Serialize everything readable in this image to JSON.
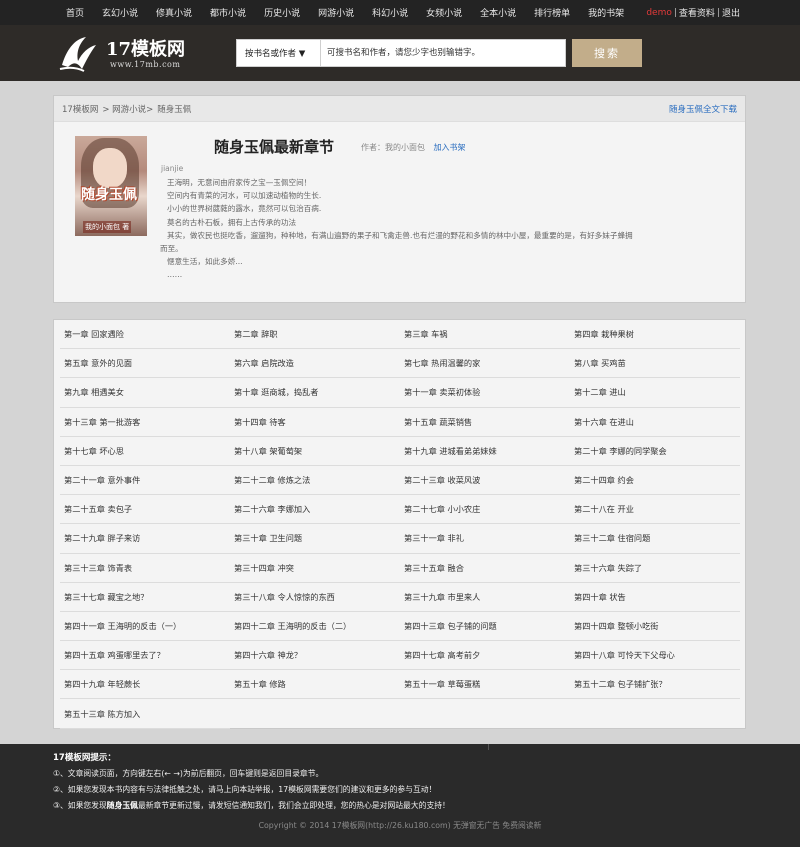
{
  "nav": {
    "items": [
      "首页",
      "玄幻小说",
      "修真小说",
      "都市小说",
      "历史小说",
      "网游小说",
      "科幻小说",
      "女频小说",
      "全本小说",
      "排行榜单",
      "我的书架"
    ],
    "user": "demo",
    "profile_link": "查看资料",
    "logout_link": "退出"
  },
  "logo": {
    "name": "17模板网",
    "url": "www.17mb.com"
  },
  "search": {
    "type_selected": "按书名或作者 ▼",
    "placeholder": "可搜书名和作者，请您少字也别输错字。",
    "button": "搜索"
  },
  "breadcrumb": [
    "17模板网",
    "> 网游小说>",
    "随身玉佩"
  ],
  "download_link": "随身玉佩全文下载",
  "book": {
    "title": "随身玉佩最新章节",
    "author_label": "作者：我的小面包",
    "add_shelf": "加入书架",
    "category": "jianjie",
    "cover_title": "随身玉佩",
    "cover_author": "我的小面包 著",
    "intro": [
      "王海明，无意间由府家传之宝—玉佩空间！",
      "空间内有青菜的河水，可以加速动植物的生长.",
      "小小的世界树葳蕤的露水，竟然可以包治百病.",
      "莫名的古朴石板，拥有上古传承的功法",
      "其实，做农民也挺吃香，遛遛狗，种种地，有满山遍野的果子和飞禽走兽.也有烂漫的野花和多情的林中小屋，最重要的是，有好多妹子蜂拥",
      "而至。",
      "惬意生活，如此多娇...",
      "……"
    ]
  },
  "chapters": [
    "第一章 回家遇险",
    "第二章 辞职",
    "第三章 车祸",
    "第四章 栽种果树",
    "第五章 意外的见面",
    "第六章 启院改造",
    "第七章 热闹温馨的家",
    "第八章 买鸡苗",
    "第九章 相遇美女",
    "第十章 逛商城，捣乱者",
    "第十一章 卖菜初体验",
    "第十二章 进山",
    "第十三章 第一批游客",
    "第十四章 待客",
    "第十五章 蔬菜销售",
    "第十六章 在进山",
    "第十七章 坏心思",
    "第十八章 架葡萄架",
    "第十九章 进城看弟弟妹妹",
    "第二十章 李娜的同学聚会",
    "第二十一章 意外事件",
    "第二十二章 修炼之法",
    "第二十三章 收菜风波",
    "第二十四章 约会",
    "第二十五章 卖包子",
    "第二十六章 李娜加入",
    "第二十七章 小小农庄",
    "第二十八在 开业",
    "第二十九章 胖子来访",
    "第三十章 卫生问题",
    "第三十一章 非礼",
    "第三十二章 住宿问题",
    "第三十三章 饰青表",
    "第三十四章 冲突",
    "第三十五章 融合",
    "第三十六章 失踪了",
    "第三十七章 藏宝之地？",
    "第三十八章 令人惊惊的东西",
    "第三十九章 市里来人",
    "第四十章 状告",
    "第四十一章 王海明的反击（一）",
    "第四十二章 王海明的反击（二）",
    "第四十三章 包子铺的问题",
    "第四十四章 整顿小吃街",
    "第四十五章 鸡蛋哪里去了？",
    "第四十六章 神龙？",
    "第四十七章 高考前夕",
    "第四十八章 可怜天下父母心",
    "第四十九章 年轻蕨长",
    "第五十章 修路",
    "第五十一章 草莓蛋糕",
    "第五十二章 包子铺扩张？",
    "第五十三章 陈方加入"
  ],
  "footer": {
    "tips_title": "17模板网提示：",
    "tip1": "①、文章阅读页面，方向键左右(← →)为前后翻页，回车键则是返回目录章节。",
    "tip2": "②、如果您发现本书内容有与法律抵触之处，请马上向本站举报，17模板网需要您们的建议和更多的参与互动！",
    "tip3_pre": "③、如果您发现",
    "tip3_book": "随身玉佩",
    "tip3_post": "最新章节更新过慢，请发短信通知我们，我们会立即处理，您的热心是对网站最大的支持！",
    "copyright": "Copyright © 2014 17模板网(http://26.ku180.com) 无弹窗无广告 免费阅读新"
  },
  "colors": {
    "accent": "#c2ad8a",
    "topbar": "#232323",
    "link": "#2a6dbf",
    "user": "#e23a3a"
  }
}
